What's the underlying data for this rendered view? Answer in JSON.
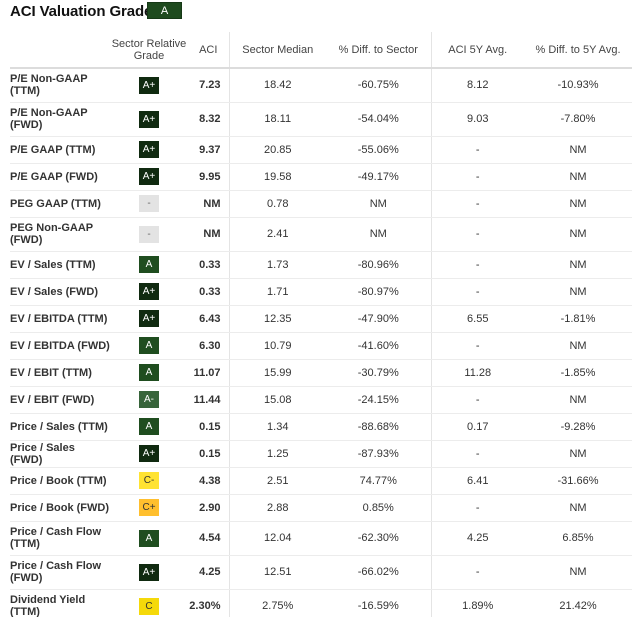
{
  "header": {
    "title": "ACI Valuation Grade",
    "overall_grade": "A"
  },
  "table": {
    "columns": [
      "",
      "Sector Relative Grade",
      "ACI",
      "Sector Median",
      "% Diff. to Sector",
      "ACI 5Y Avg.",
      "% Diff. to 5Y Avg."
    ],
    "rows": [
      {
        "metric": "P/E Non-GAAP (TTM)",
        "grade": "A+",
        "aci": "7.23",
        "sector_median": "18.42",
        "diff_sector": "-60.75%",
        "avg5y": "8.12",
        "diff_5y": "-10.93%"
      },
      {
        "metric": "P/E Non-GAAP (FWD)",
        "grade": "A+",
        "aci": "8.32",
        "sector_median": "18.11",
        "diff_sector": "-54.04%",
        "avg5y": "9.03",
        "diff_5y": "-7.80%"
      },
      {
        "metric": "P/E GAAP (TTM)",
        "grade": "A+",
        "aci": "9.37",
        "sector_median": "20.85",
        "diff_sector": "-55.06%",
        "avg5y": "-",
        "diff_5y": "NM"
      },
      {
        "metric": "P/E GAAP (FWD)",
        "grade": "A+",
        "aci": "9.95",
        "sector_median": "19.58",
        "diff_sector": "-49.17%",
        "avg5y": "-",
        "diff_5y": "NM"
      },
      {
        "metric": "PEG GAAP (TTM)",
        "grade": "-",
        "aci": "NM",
        "sector_median": "0.78",
        "diff_sector": "NM",
        "avg5y": "-",
        "diff_5y": "NM"
      },
      {
        "metric": "PEG Non-GAAP (FWD)",
        "grade": "-",
        "aci": "NM",
        "sector_median": "2.41",
        "diff_sector": "NM",
        "avg5y": "-",
        "diff_5y": "NM"
      },
      {
        "metric": "EV / Sales (TTM)",
        "grade": "A",
        "aci": "0.33",
        "sector_median": "1.73",
        "diff_sector": "-80.96%",
        "avg5y": "-",
        "diff_5y": "NM"
      },
      {
        "metric": "EV / Sales (FWD)",
        "grade": "A+",
        "aci": "0.33",
        "sector_median": "1.71",
        "diff_sector": "-80.97%",
        "avg5y": "-",
        "diff_5y": "NM"
      },
      {
        "metric": "EV / EBITDA (TTM)",
        "grade": "A+",
        "aci": "6.43",
        "sector_median": "12.35",
        "diff_sector": "-47.90%",
        "avg5y": "6.55",
        "diff_5y": "-1.81%"
      },
      {
        "metric": "EV / EBITDA (FWD)",
        "grade": "A",
        "aci": "6.30",
        "sector_median": "10.79",
        "diff_sector": "-41.60%",
        "avg5y": "-",
        "diff_5y": "NM"
      },
      {
        "metric": "EV / EBIT (TTM)",
        "grade": "A",
        "aci": "11.07",
        "sector_median": "15.99",
        "diff_sector": "-30.79%",
        "avg5y": "11.28",
        "diff_5y": "-1.85%"
      },
      {
        "metric": "EV / EBIT (FWD)",
        "grade": "A-",
        "aci": "11.44",
        "sector_median": "15.08",
        "diff_sector": "-24.15%",
        "avg5y": "-",
        "diff_5y": "NM"
      },
      {
        "metric": "Price / Sales (TTM)",
        "grade": "A",
        "aci": "0.15",
        "sector_median": "1.34",
        "diff_sector": "-88.68%",
        "avg5y": "0.17",
        "diff_5y": "-9.28%"
      },
      {
        "metric": "Price / Sales (FWD)",
        "grade": "A+",
        "aci": "0.15",
        "sector_median": "1.25",
        "diff_sector": "-87.93%",
        "avg5y": "-",
        "diff_5y": "NM"
      },
      {
        "metric": "Price / Book (TTM)",
        "grade": "C-",
        "aci": "4.38",
        "sector_median": "2.51",
        "diff_sector": "74.77%",
        "avg5y": "6.41",
        "diff_5y": "-31.66%"
      },
      {
        "metric": "Price / Book (FWD)",
        "grade": "C+",
        "aci": "2.90",
        "sector_median": "2.88",
        "diff_sector": "0.85%",
        "avg5y": "-",
        "diff_5y": "NM"
      },
      {
        "metric": "Price / Cash Flow (TTM)",
        "grade": "A",
        "aci": "4.54",
        "sector_median": "12.04",
        "diff_sector": "-62.30%",
        "avg5y": "4.25",
        "diff_5y": "6.85%"
      },
      {
        "metric": "Price / Cash Flow (FWD)",
        "grade": "A+",
        "aci": "4.25",
        "sector_median": "12.51",
        "diff_sector": "-66.02%",
        "avg5y": "-",
        "diff_5y": "NM"
      },
      {
        "metric": "Dividend Yield (TTM)",
        "grade": "C",
        "aci": "2.30%",
        "sector_median": "2.75%",
        "diff_sector": "-16.59%",
        "avg5y": "1.89%",
        "diff_5y": "21.42%"
      }
    ]
  },
  "grade_colors": {
    "A+": "#102a10",
    "A": "#1f4d1f",
    "A-": "#37643a",
    "C-": "#ffe333",
    "C+": "#ffbf2e",
    "C": "#f5d90a",
    "-": "#e3e3e3"
  }
}
